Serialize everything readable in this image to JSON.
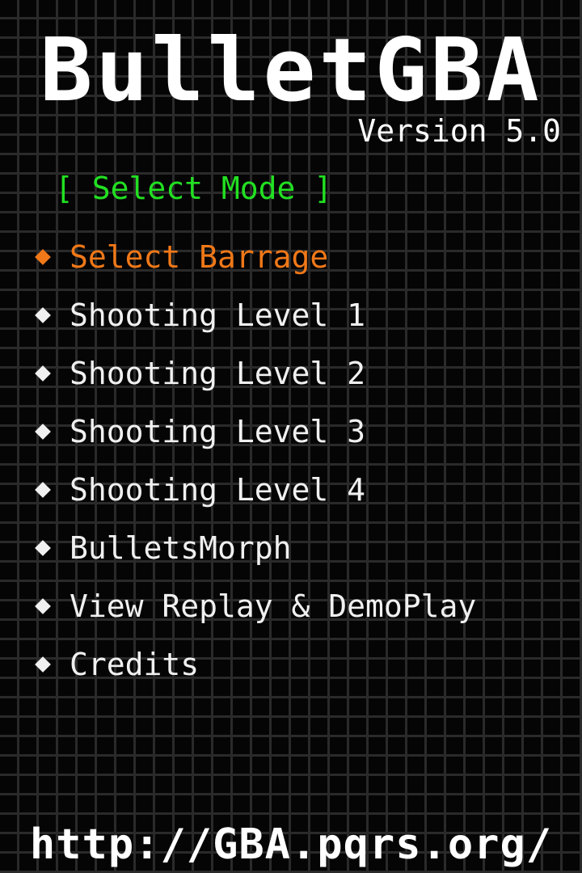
{
  "game": {
    "title": "BulletGBA",
    "version": "Version 5.0"
  },
  "mode_label": "[ Select Mode ]",
  "menu": {
    "items": [
      {
        "label": "Select Barrage",
        "selected": true
      },
      {
        "label": "Shooting Level 1",
        "selected": false
      },
      {
        "label": "Shooting Level 2",
        "selected": false
      },
      {
        "label": "Shooting Level 3",
        "selected": false
      },
      {
        "label": "Shooting Level 4",
        "selected": false
      },
      {
        "label": "BulletsMorph",
        "selected": false
      },
      {
        "label": "View Replay & DemoPlay",
        "selected": false
      },
      {
        "label": "Credits",
        "selected": false
      }
    ]
  },
  "footer": {
    "url": "http://GBA.pqrs.org/"
  },
  "colors": {
    "background": "#050505",
    "grid": "#2a2a2a",
    "text": "#f0f0f0",
    "selected": "#f07818",
    "mode_label": "#22e022"
  },
  "icons": {
    "menu_bullet": "diamond-bullet-icon"
  }
}
